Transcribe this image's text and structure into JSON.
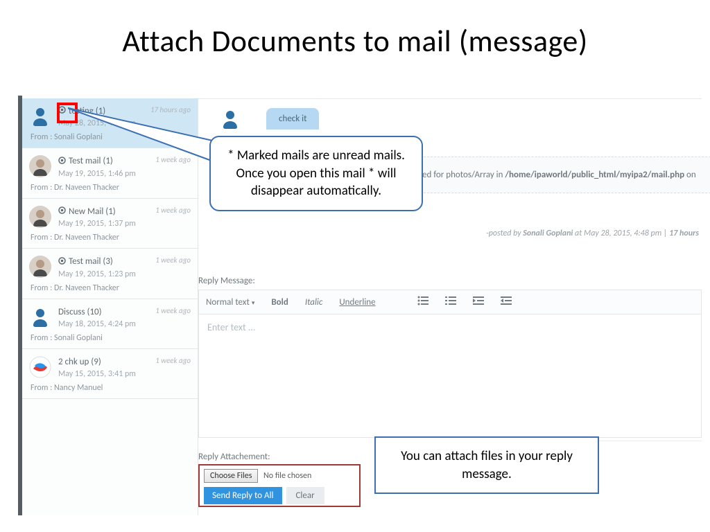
{
  "slide_title": "Attach  Documents to mail (message)",
  "sidebar": {
    "items": [
      {
        "unread": true,
        "avatar": "silhouette",
        "subject": "testing (1)",
        "date": "May 28, 2015, 4:48 pm",
        "age": "17 hours ago",
        "from": "From : Sonali Goplani",
        "selected": true
      },
      {
        "unread": true,
        "avatar": "man",
        "subject": "Test mail (1)",
        "date": "May 19, 2015, 1:46 pm",
        "age": "1 week ago",
        "from": "From : Dr. Naveen Thacker"
      },
      {
        "unread": true,
        "avatar": "man",
        "subject": "New Mail (1)",
        "date": "May 19, 2015, 1:37 pm",
        "age": "1 week ago",
        "from": "From : Dr. Naveen Thacker"
      },
      {
        "unread": true,
        "avatar": "man",
        "subject": "Test mail (3)",
        "date": "May 19, 2015, 1:23 pm",
        "age": "1 week ago",
        "from": "From : Dr. Naveen Thacker"
      },
      {
        "unread": false,
        "avatar": "silhouette",
        "subject": "Discuss (10)",
        "date": "May 18, 2015, 4:24 pm",
        "age": "1 week ago",
        "from": "From : Sonali Goplani"
      },
      {
        "unread": false,
        "avatar": "bird",
        "subject": "2 chk up (9)",
        "date": "May 15, 2015, 3:41 pm",
        "age": "1 week ago",
        "from": "From : Nancy Manuel"
      }
    ]
  },
  "message": {
    "chip": "check it",
    "body_fragment_prefix": "ed for photos/Array in ",
    "body_fragment_path": "/home/ipaworld/public_html/myipa2/mail.php",
    "body_fragment_suffix": " on",
    "posted_prefix": "-posted by ",
    "posted_author": "Sonali Goplani",
    "posted_mid": " at ",
    "posted_date": "May 28, 2015, 4:48 pm",
    "posted_sep": " | ",
    "posted_age": "17 hours"
  },
  "reply": {
    "label": "Reply Message:",
    "placeholder": "Enter text ...",
    "attach_label": "Reply Attachement:",
    "choose_files": "Choose Files",
    "no_file": "No file chosen",
    "send": "Send Reply to All",
    "clear": "Clear"
  },
  "toolbar": {
    "normal": "Normal text",
    "bold": "Bold",
    "italic": "Italic",
    "underline": "Underline"
  },
  "callouts": {
    "unread": "* Marked mails are unread mails. Once you open this mail * will disappear automatically.",
    "attach": "You can attach files in your reply message."
  }
}
